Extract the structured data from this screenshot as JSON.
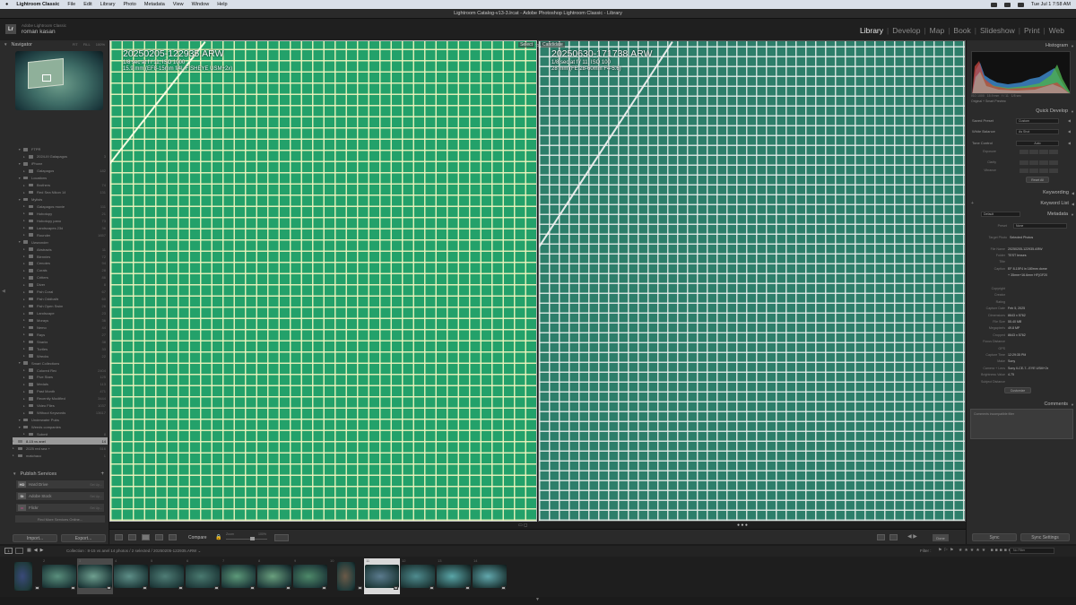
{
  "menubar": {
    "app": "Lightroom Classic",
    "items": [
      "File",
      "Edit",
      "Library",
      "Photo",
      "Metadata",
      "View",
      "Window",
      "Help"
    ],
    "clock": "Tue Jul 1  7:58 AM"
  },
  "window_title": "Lightroom Catalog-v13-3.lrcat - Adobe Photoshop Lightroom Classic - Library",
  "identity": {
    "small": "Adobe Lightroom Classic",
    "name": "roman kasan"
  },
  "modules": [
    {
      "label": "Library",
      "active": true
    },
    {
      "label": "Develop",
      "active": false
    },
    {
      "label": "Map",
      "active": false
    },
    {
      "label": "Book",
      "active": false
    },
    {
      "label": "Slideshow",
      "active": false
    },
    {
      "label": "Print",
      "active": false
    },
    {
      "label": "Web",
      "active": false
    }
  ],
  "left_panel": {
    "navigator_title": "Navigator",
    "zoom_options": [
      "FIT",
      "FILL",
      "100%"
    ],
    "collections": [
      {
        "label": "FTPR",
        "count": "",
        "level": 1,
        "type": "set"
      },
      {
        "label": "2024-III Galapagos",
        "count": "3",
        "level": 2,
        "type": "col"
      },
      {
        "label": "iPhone",
        "count": "",
        "level": 1,
        "type": "set"
      },
      {
        "label": "Galapagos",
        "count": "182",
        "level": 2,
        "type": "col"
      },
      {
        "label": "Locations",
        "count": "",
        "level": 1,
        "type": "set"
      },
      {
        "label": "Brothers",
        "count": "74",
        "level": 2,
        "type": "col"
      },
      {
        "label": "Red Sea Nikon 14",
        "count": "131",
        "level": 2,
        "type": "col"
      },
      {
        "label": "Mylists",
        "count": "",
        "level": 1,
        "type": "set"
      },
      {
        "label": "Galapagos movie",
        "count": "111",
        "level": 2,
        "type": "col"
      },
      {
        "label": "Hobotopy",
        "count": "21",
        "level": 2,
        "type": "col"
      },
      {
        "label": "Hobotopy pano",
        "count": "73",
        "level": 2,
        "type": "col"
      },
      {
        "label": "Landscapes 23d",
        "count": "36",
        "level": 2,
        "type": "col"
      },
      {
        "label": "Rounder",
        "count": "1657",
        "level": 2,
        "type": "col"
      },
      {
        "label": "Uwwonder",
        "count": "",
        "level": 1,
        "type": "set"
      },
      {
        "label": "Abstracts",
        "count": "11",
        "level": 2,
        "type": "col"
      },
      {
        "label": "Blennies",
        "count": "72",
        "level": 2,
        "type": "col"
      },
      {
        "label": "Cenotes",
        "count": "94",
        "level": 2,
        "type": "col"
      },
      {
        "label": "Corals",
        "count": "28",
        "level": 2,
        "type": "col"
      },
      {
        "label": "Critters",
        "count": "86",
        "level": 2,
        "type": "col"
      },
      {
        "label": "Diver",
        "count": "8",
        "level": 2,
        "type": "col"
      },
      {
        "label": "Fish Coral",
        "count": "67",
        "level": 2,
        "type": "col"
      },
      {
        "label": "Fish Oddballs",
        "count": "60",
        "level": 2,
        "type": "col"
      },
      {
        "label": "Fish Open Swim",
        "count": "26",
        "level": 2,
        "type": "col"
      },
      {
        "label": "Landscape",
        "count": "23",
        "level": 2,
        "type": "col"
      },
      {
        "label": "Morays",
        "count": "36",
        "level": 2,
        "type": "col"
      },
      {
        "label": "Nemo",
        "count": "44",
        "level": 2,
        "type": "col"
      },
      {
        "label": "Rays",
        "count": "27",
        "level": 2,
        "type": "col"
      },
      {
        "label": "Sharks",
        "count": "38",
        "level": 2,
        "type": "col"
      },
      {
        "label": "Turtles",
        "count": "33",
        "level": 2,
        "type": "col"
      },
      {
        "label": "Wrecks",
        "count": "22",
        "level": 2,
        "type": "col"
      },
      {
        "label": "Smart Collections",
        "count": "",
        "level": 1,
        "type": "set"
      },
      {
        "label": "Colored Red",
        "count": "2404",
        "level": 2,
        "type": "col"
      },
      {
        "label": "Five Stars",
        "count": "125",
        "level": 2,
        "type": "col"
      },
      {
        "label": "Medals",
        "count": "113",
        "level": 2,
        "type": "col"
      },
      {
        "label": "Past Month",
        "count": "471",
        "level": 2,
        "type": "col"
      },
      {
        "label": "Recently Modified",
        "count": "3444",
        "level": 2,
        "type": "col"
      },
      {
        "label": "Video Files",
        "count": "1037",
        "level": 2,
        "type": "col"
      },
      {
        "label": "Without Keywords",
        "count": "13617",
        "level": 2,
        "type": "col"
      },
      {
        "label": "Underwater Pubs",
        "count": "",
        "level": 1,
        "type": "set"
      },
      {
        "label": "Weeds companies",
        "count": "",
        "level": 1,
        "type": "set"
      },
      {
        "label": "Submit",
        "count": "8",
        "level": 2,
        "type": "col"
      },
      {
        "label": "8-15 vs anel",
        "count": "14",
        "level": 0,
        "type": "col",
        "selected": true
      },
      {
        "label": "2025 red sea  +",
        "count": "516",
        "level": 0,
        "type": "col"
      },
      {
        "label": "matchaco",
        "count": "1",
        "level": 0,
        "type": "col"
      }
    ],
    "publish_title": "Publish Services",
    "publish_services": [
      {
        "icon": "HD",
        "label": "Hard Drive",
        "action": "Set Up..."
      },
      {
        "icon": "St",
        "label": "Adobe Stock",
        "action": "Set Up..."
      },
      {
        "icon": "••",
        "label": "Flickr",
        "action": "Set Up..."
      }
    ],
    "find_more": "Find More Services Online...",
    "import_label": "Import...",
    "export_label": "Export..."
  },
  "compare": {
    "select": {
      "tag": "Select",
      "filename": "20250205-122935.ARW",
      "exposure": "1/8 sec at f / 11, ISO 1000",
      "lens": "15.9 mm (EF8-15mm f/4L FISHEYE USM+2x)"
    },
    "candidate": {
      "tag": "Candidate",
      "filename": "20250630-171738.ARW",
      "exposure": "1/8 sec at f / 11, ISO 100",
      "lens": "28 mm (FE 28-60mm F4-5.6)"
    }
  },
  "toolbar": {
    "compare_label": "Compare",
    "zoom_label": "Zoom",
    "zoom_value": "100%",
    "done_label": "Done"
  },
  "right_panel": {
    "histogram_title": "Histogram",
    "hist_info": [
      "ISO 1000",
      "15.9 mm",
      "f / 11",
      "1/8 sec"
    ],
    "hist_sub": "Original + Smart Preview",
    "quick_develop_title": "Quick Develop",
    "saved_preset_label": "Saved Preset",
    "saved_preset_value": "Custom",
    "white_balance_label": "White Balance",
    "white_balance_value": "As Shot",
    "tone_control_label": "Tone Control",
    "tone_control_value": "Auto",
    "adjustments": [
      "Exposure",
      "Clarity",
      "Vibrance"
    ],
    "reset_label": "Reset All",
    "keywording_title": "Keywording",
    "keyword_list_title": "Keyword List",
    "metadata_title": "Metadata",
    "metadata_preset_default": "Default",
    "preset_label": "Preset",
    "preset_value": "None",
    "target_photo_label": "Target Photo",
    "target_photo_value": "Selected Photos",
    "metadata": [
      {
        "k": "File Name",
        "v": "20250205-122935.ARW"
      },
      {
        "k": "Folder",
        "v": "TEST lenses"
      },
      {
        "k": "Title",
        "v": ""
      },
      {
        "k": "Caption",
        "v": "EF 8-15F4 in 180mm dome"
      },
      {
        "k": "",
        "v": "+ 35mm+16.6mm HF(GF20"
      },
      {
        "k": "",
        "v": ""
      },
      {
        "k": "Copyright",
        "v": ""
      },
      {
        "k": "Creator",
        "v": ""
      },
      {
        "k": "Rating",
        "v": ""
      },
      {
        "k": "Capture Date",
        "v": "Feb 5, 2025"
      },
      {
        "k": "Dimensions",
        "v": "8643 x 5762"
      },
      {
        "k": "File Size",
        "v": "55.40 MB"
      },
      {
        "k": "Megapixels",
        "v": "49.8 MP"
      },
      {
        "k": "Cropped",
        "v": "8643 x 5762"
      },
      {
        "k": "Focus Distance",
        "v": ""
      },
      {
        "k": "GPS",
        "v": ""
      },
      {
        "k": "Capture Time",
        "v": "12:29:35 PM"
      },
      {
        "k": "Make",
        "v": "Sony"
      },
      {
        "k": "Camera + Lens",
        "v": "Sony ILCE-7...EYE USM+2x"
      },
      {
        "k": "Brightness Value",
        "v": "4.75"
      },
      {
        "k": "Subject Distance",
        "v": ""
      }
    ],
    "customize_label": "Customize",
    "comments_title": "Comments",
    "comments_placeholder": "Comments incompatible filter",
    "sync_label": "Sync",
    "sync_settings_label": "Sync Settings"
  },
  "filmbar": {
    "screen1": "1",
    "status": "Collection : 8-15 vs anel     14 photos / 2 selected / 20250205-122935.ARW ⌄",
    "filter_label": "Filter :",
    "no_filter": "No Filter"
  },
  "filmstrip": [
    {
      "num": "",
      "color": "#3a4a7a",
      "state": ""
    },
    {
      "num": "2",
      "color": "#5a8f7d",
      "state": ""
    },
    {
      "num": "3",
      "color": "#6fa090",
      "state": "sel"
    },
    {
      "num": "4",
      "color": "#5e8f88",
      "state": ""
    },
    {
      "num": "5",
      "color": "#4f7d76",
      "state": ""
    },
    {
      "num": "6",
      "color": "#4a7a70",
      "state": ""
    },
    {
      "num": "7",
      "color": "#5d9a7a",
      "state": ""
    },
    {
      "num": "8",
      "color": "#6aa07e",
      "state": ""
    },
    {
      "num": "9",
      "color": "#4e8a6a",
      "state": ""
    },
    {
      "num": "10",
      "color": "#6b5a48",
      "state": ""
    },
    {
      "num": "11",
      "color": "#5b7b8e",
      "state": "cand"
    },
    {
      "num": "12",
      "color": "#4f8c8f",
      "state": ""
    },
    {
      "num": "13",
      "color": "#5aa6a8",
      "state": ""
    },
    {
      "num": "14",
      "color": "#62a8ad",
      "state": ""
    }
  ]
}
